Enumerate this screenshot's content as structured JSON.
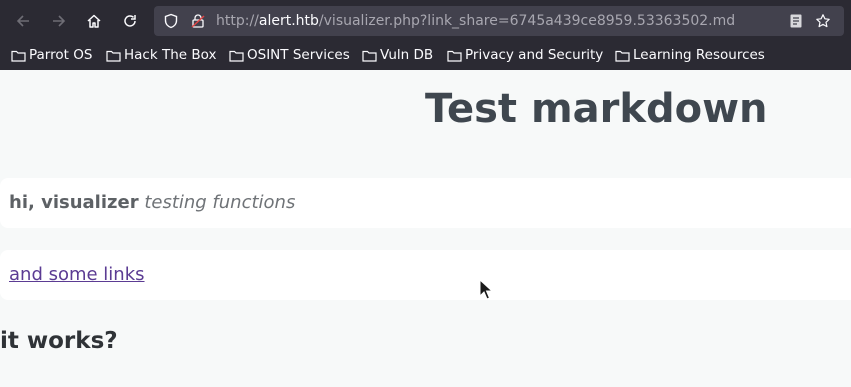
{
  "browser": {
    "url_prefix": "http://",
    "url_host": "alert.htb",
    "url_path": "/visualizer.php?link_share=6745a439ce8959.53363502.md",
    "bookmarks": [
      "Parrot OS",
      "Hack The Box",
      "OSINT Services",
      "Vuln DB",
      "Privacy and Security",
      "Learning Resources"
    ]
  },
  "page": {
    "title": "Test markdown",
    "para1_bold": "hi, visualizer",
    "para1_italic": "testing functions",
    "link_text": "and some links",
    "heading2": "it works?"
  },
  "icons": [
    "back-arrow-icon",
    "forward-arrow-icon",
    "home-icon",
    "reload-icon",
    "shield-icon",
    "lock-icon",
    "reader-view-icon",
    "bookmark-star-icon",
    "folder-icon",
    "mouse-pointer-icon"
  ]
}
